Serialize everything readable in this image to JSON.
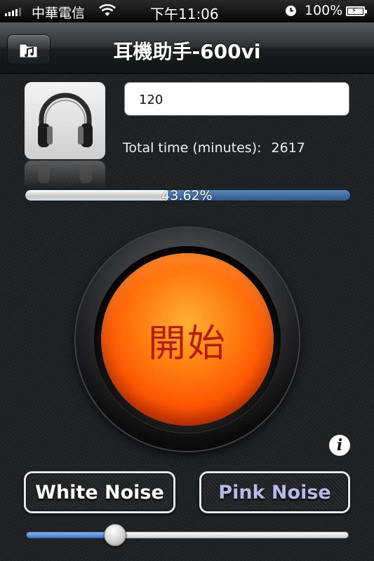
{
  "status_bar": {
    "carrier": "中華電信",
    "time": "下午11:06",
    "battery": "100%"
  },
  "nav": {
    "title": "耳機助手-600vi"
  },
  "main": {
    "minutes_input": "120",
    "total_time_label": "Total time (minutes):",
    "total_time_value": "2617",
    "progress_label": "43.62%",
    "progress_fraction": 0.4362,
    "start_button_label": "開始",
    "info_label": "i",
    "white_noise_label": "White Noise",
    "pink_noise_label": "Pink Noise",
    "volume_fraction": 0.26
  },
  "colors": {
    "progress_track": "#3f6da3",
    "start_button": "#ff6a0a",
    "pink_noise_text": "#b7b9e8",
    "slider_fill": "#3c79c9"
  }
}
